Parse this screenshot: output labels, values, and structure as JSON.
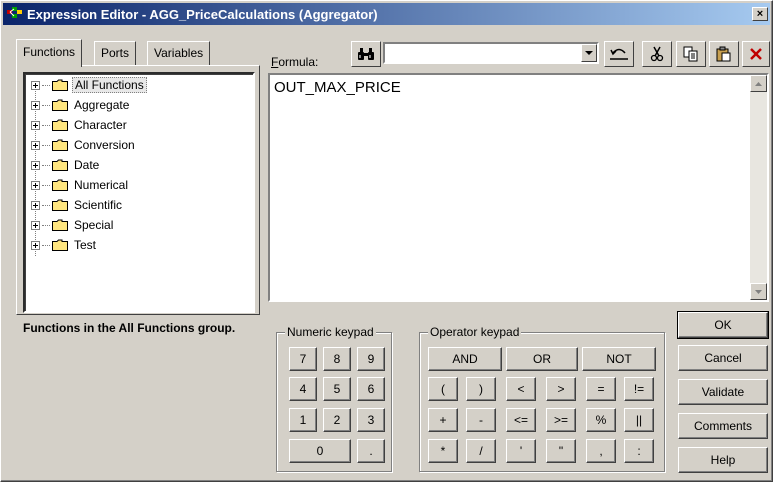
{
  "window": {
    "title": "Expression Editor - AGG_PriceCalculations (Aggregator)",
    "close_glyph": "×",
    "title_gradient_start": "#0a246a",
    "title_gradient_end": "#a6caf0"
  },
  "tabs": [
    {
      "label": "Functions",
      "active": true
    },
    {
      "label": "Ports",
      "active": false
    },
    {
      "label": "Variables",
      "active": false
    }
  ],
  "tree": {
    "items": [
      {
        "label": "All Functions",
        "selected": true
      },
      {
        "label": "Aggregate"
      },
      {
        "label": "Character"
      },
      {
        "label": "Conversion"
      },
      {
        "label": "Date"
      },
      {
        "label": "Numerical"
      },
      {
        "label": "Scientific"
      },
      {
        "label": "Special"
      },
      {
        "label": "Test"
      }
    ]
  },
  "description": "Functions in the All Functions group.",
  "formula": {
    "label": "Formula:",
    "text": "OUT_MAX_PRICE",
    "search_value": ""
  },
  "toolbar": {
    "find_icon": "binoculars-icon",
    "undo_icon": "undo-icon",
    "cut_icon": "scissors-icon",
    "copy_icon": "copy-icon",
    "paste_icon": "paste-icon",
    "delete_icon": "delete-x-icon"
  },
  "numeric_keypad": {
    "legend": "Numeric keypad",
    "keys": [
      "7",
      "8",
      "9",
      "4",
      "5",
      "6",
      "1",
      "2",
      "3",
      "0",
      "."
    ]
  },
  "operator_keypad": {
    "legend": "Operator keypad",
    "logic": [
      "AND",
      "OR",
      "NOT"
    ],
    "row2": [
      "(",
      ")",
      "<",
      ">",
      "=",
      "!="
    ],
    "row3": [
      "+",
      "-",
      "<=",
      ">=",
      "%",
      "||"
    ],
    "row4": [
      "*",
      "/",
      "'",
      "\"",
      ",",
      ":"
    ]
  },
  "buttons": {
    "ok": "OK",
    "cancel": "Cancel",
    "validate": "Validate",
    "comments": "Comments",
    "help": "Help"
  },
  "colors": {
    "dialog_bg": "#d4d0c8",
    "folder_yellow": "#ffe680",
    "delete_red": "#c00000"
  }
}
